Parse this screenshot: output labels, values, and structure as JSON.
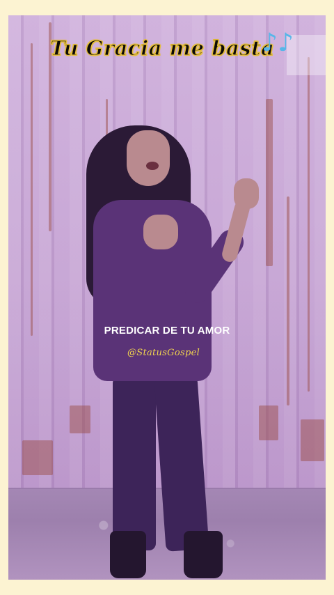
{
  "title": "Tu Gracia me basta",
  "music_notes": "♪♪",
  "lyric": "PREDICAR DE TU AMOR",
  "watermark": "@StatusGospel",
  "colors": {
    "frame": "#fcf3d2",
    "title_outline": "#e5be3d",
    "lyric_text": "#ffffff",
    "watermark_text": "#f2d44e",
    "notes": "#58b6e8"
  }
}
